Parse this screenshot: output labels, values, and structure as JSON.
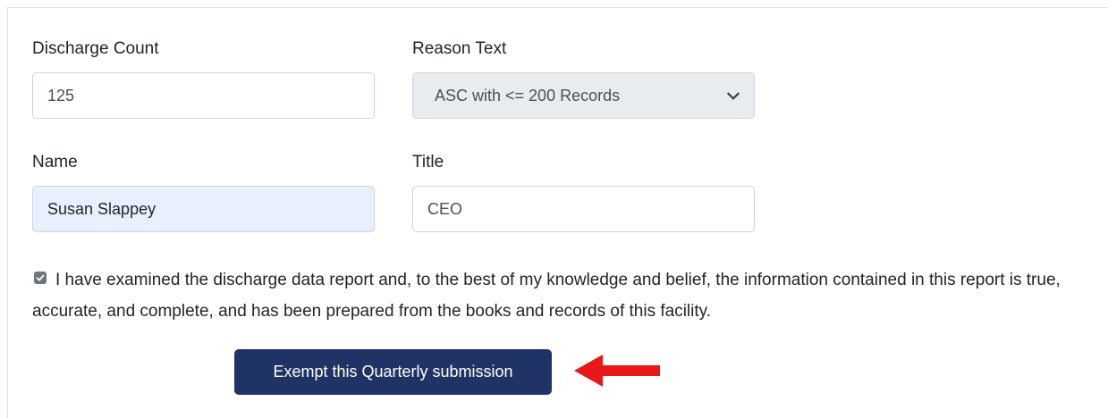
{
  "form": {
    "discharge_count": {
      "label": "Discharge Count",
      "value": "125"
    },
    "reason_text": {
      "label": "Reason Text",
      "selected": "ASC with <= 200 Records"
    },
    "name": {
      "label": "Name",
      "value": "Susan Slappey"
    },
    "title": {
      "label": "Title",
      "value": "CEO"
    },
    "certification": {
      "checked": true,
      "text": "I have examined the discharge data report and, to the best of my knowledge and belief, the information contained in this report is true, accurate, and complete, and has been prepared from the books and records of this facility."
    },
    "submit_label": "Exempt this Quarterly submission"
  },
  "colors": {
    "button_bg": "#1f3464",
    "arrow": "#e8181a",
    "autofill_bg": "#e8f0fe",
    "select_bg": "#e9ecef"
  },
  "icons": {
    "select_caret": "chevron-down-icon",
    "checkbox_mark": "check-icon",
    "annotation": "arrow-left-icon"
  }
}
